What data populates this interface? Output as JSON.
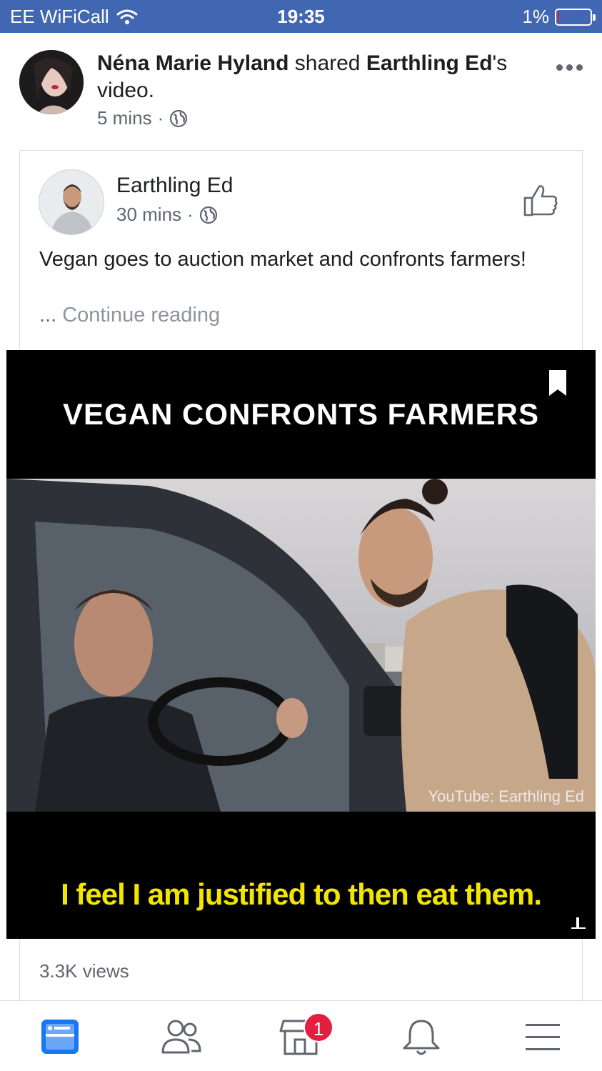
{
  "status_bar": {
    "carrier": "EE WiFiCall",
    "time": "19:35",
    "battery_percent": "1%",
    "battery_level": 0.01
  },
  "share_post": {
    "author": "Néna Marie Hyland",
    "action": "shared",
    "original_author_possessive": "Earthling Ed",
    "possessive_suffix": "'s",
    "object": "video.",
    "time": "5 mins",
    "separator": "·",
    "privacy_icon": "globe-icon",
    "more_icon": "more-horizontal-icon"
  },
  "inner_post": {
    "author": "Earthling Ed",
    "time": "30 mins",
    "separator": "·",
    "privacy_icon": "globe-icon",
    "text": "Vegan goes to auction market and confronts farmers!",
    "ellipsis": "...",
    "continue_label": "Continue reading",
    "like_icon": "thumbs-up-icon"
  },
  "video": {
    "title": "VEGAN CONFRONTS FARMERS",
    "watermark": "YouTube: Earthling Ed",
    "subtitle": "I feel I am justified to then eat them.",
    "bookmark_icon": "bookmark-icon",
    "volume_icon": "volume-icon"
  },
  "views": "3.3K views",
  "tab_bar": {
    "items": [
      {
        "name": "news-feed",
        "icon": "news-feed-icon",
        "active": true
      },
      {
        "name": "friends",
        "icon": "friends-icon",
        "active": false
      },
      {
        "name": "marketplace",
        "icon": "marketplace-icon",
        "active": false,
        "badge": "1"
      },
      {
        "name": "notifications",
        "icon": "bell-icon",
        "active": false
      },
      {
        "name": "menu",
        "icon": "hamburger-menu-icon",
        "active": false
      }
    ]
  },
  "colors": {
    "brand": "#4267b2",
    "active_tab": "#1877f2",
    "subtitle_yellow": "#f2e600",
    "badge_red": "#e41e3f"
  }
}
